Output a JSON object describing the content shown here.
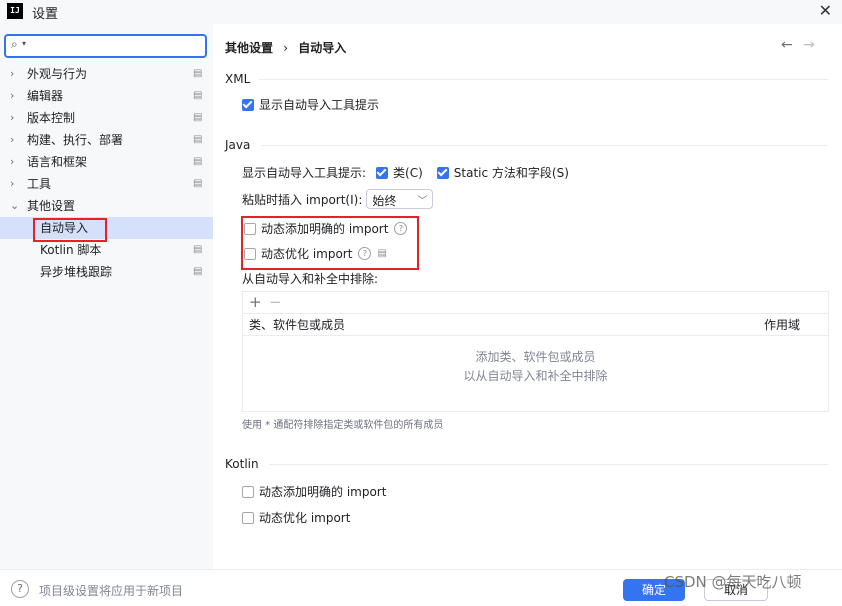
{
  "window": {
    "title": "设置",
    "app_icon": "IJ"
  },
  "sidebar": {
    "search_placeholder": "",
    "items": [
      {
        "label": "外观与行为"
      },
      {
        "label": "编辑器"
      },
      {
        "label": "版本控制"
      },
      {
        "label": "构建、执行、部署"
      },
      {
        "label": "语言和框架"
      },
      {
        "label": "工具"
      },
      {
        "label": "其他设置"
      },
      {
        "label": "自动导入"
      },
      {
        "label": "Kotlin 脚本"
      },
      {
        "label": "异步堆栈跟踪"
      }
    ]
  },
  "main": {
    "breadcrumb": {
      "parent": "其他设置",
      "separator": "›",
      "current": "自动导入"
    },
    "xml": {
      "title": "XML",
      "show_popup": {
        "label": "显示自动导入工具提示",
        "checked": true
      }
    },
    "java": {
      "title": "Java",
      "show_popup_label": "显示自动导入工具提示:",
      "classes": {
        "label": "类(C)",
        "checked": true
      },
      "static": {
        "label": "Static 方法和字段(S)",
        "checked": true
      },
      "paste_label": "粘贴时插入 import(I):",
      "paste_value": "始终",
      "add_unambiguous": {
        "label": "动态添加明确的 import",
        "checked": false
      },
      "optimize": {
        "label": "动态优化 import",
        "checked": false
      },
      "exclude_label": "从自动导入和补全中排除:",
      "table": {
        "col1": "类、软件包或成员",
        "col2": "作用域"
      },
      "empty_line1": "添加类、软件包或成员",
      "empty_line2": "以从自动导入和补全中排除",
      "hint": "使用 * 通配符排除指定类或软件包的所有成员"
    },
    "kotlin": {
      "title": "Kotlin",
      "add_unambiguous": {
        "label": "动态添加明确的 import",
        "checked": false
      },
      "optimize": {
        "label": "动态优化 import",
        "checked": false
      }
    }
  },
  "footer": {
    "note": "项目级设置将应用于新项目",
    "ok": "确定",
    "cancel": "取消",
    "watermark": "CSDN @每天吃八顿"
  },
  "colors": {
    "accent": "#3574f0",
    "highlight": "#e0242a",
    "selected_bg": "#d5e1fb"
  }
}
